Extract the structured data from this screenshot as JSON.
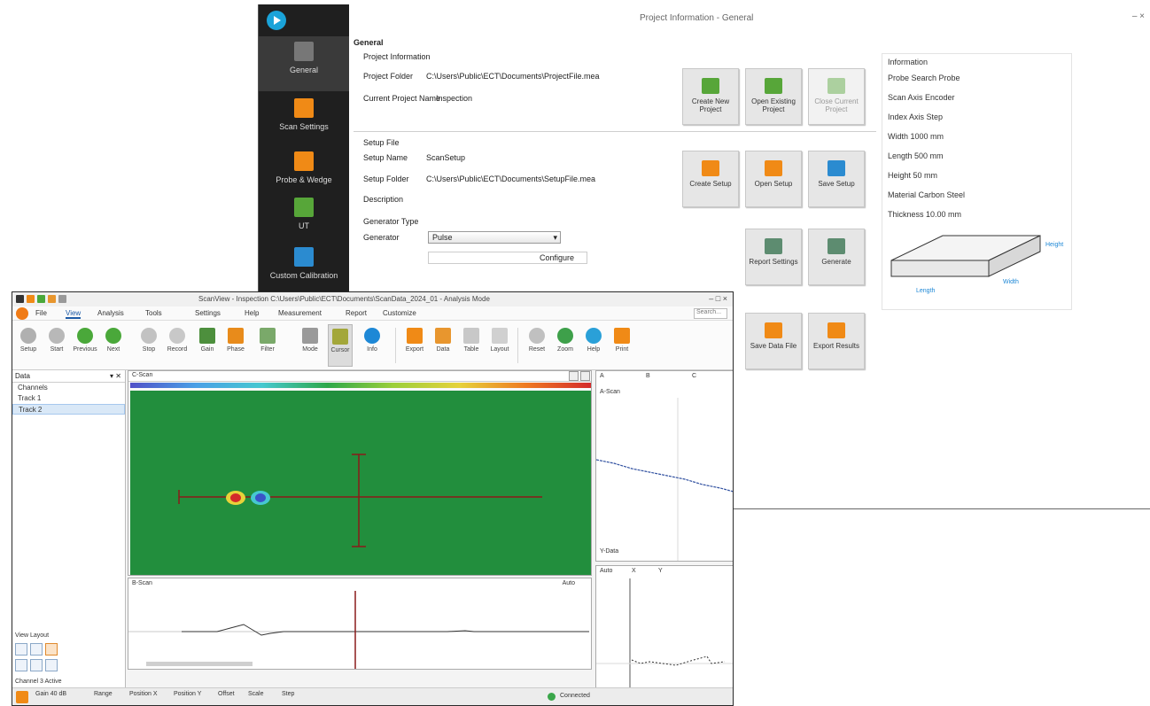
{
  "back_window": {
    "title": "Project Information - General",
    "window_controls": "– ×",
    "sidebar": [
      {
        "label": "General",
        "icon": "general-icon"
      },
      {
        "label": "Scan Settings",
        "icon": "scan-settings-icon"
      },
      {
        "label": "Probe & Wedge",
        "icon": "probe-wedge-icon"
      },
      {
        "label": "UT",
        "icon": "ut-icon"
      },
      {
        "label": "Custom Calibration",
        "icon": "calibration-icon"
      }
    ],
    "section_title": "General",
    "project_info": {
      "heading": "Project Information",
      "path_label": "Project Folder",
      "path_value": "C:\\Users\\Public\\ECT\\Documents\\ProjectFile.mea",
      "name_label": "Current Project Name",
      "name_value": "Inspection"
    },
    "project_buttons": [
      {
        "label": "Create New Project",
        "disabled": false
      },
      {
        "label": "Open Existing Project",
        "disabled": false
      },
      {
        "label": "Close Current Project",
        "disabled": true
      }
    ],
    "setup_info": {
      "heading": "Setup File",
      "setup_label": "Setup Name",
      "setup_value": "ScanSetup",
      "file_label": "Setup Folder",
      "file_value": "C:\\Users\\Public\\ECT\\Documents\\SetupFile.mea",
      "notes_label": "Description"
    },
    "setup_buttons": [
      {
        "label": "Create Setup"
      },
      {
        "label": "Open Setup"
      },
      {
        "label": "Save Setup"
      }
    ],
    "generator": {
      "heading": "Generator Type",
      "label": "Generator",
      "selected": "Pulse",
      "input_value": "Configure"
    },
    "report_buttons": [
      {
        "label": "Report Settings"
      },
      {
        "label": "Generate"
      }
    ],
    "lower_buttons": [
      {
        "label": "Save Data File"
      },
      {
        "label": "Export Results"
      }
    ],
    "info_panel": {
      "heading": "Information",
      "rows": [
        "Probe        Search Probe",
        "Scan Axis   Encoder",
        "Index Axis   Step",
        "Width        1000 mm",
        "Length        500 mm",
        "Height       50 mm",
        "Material     Carbon Steel",
        "Thickness    10.00 mm"
      ],
      "dim_labels": [
        "Length",
        "Width",
        "Height"
      ]
    }
  },
  "front_window": {
    "title": "ScanView - Inspection C:\\Users\\Public\\ECT\\Documents\\ScanData_2024_01 - Analysis Mode",
    "window_controls": "– □ ×",
    "menu_tabs": [
      "File",
      "View",
      "Analysis",
      "Tools",
      "Settings",
      "Help",
      "Measurement",
      "Report",
      "Customize"
    ],
    "active_tab": "View",
    "search_placeholder": "Search...",
    "ribbon": [
      {
        "label": "Setup",
        "color": "#b0b0b0"
      },
      {
        "label": "Start",
        "color": "#b8b8b8"
      },
      {
        "label": "Previous",
        "color": "#4aa83a"
      },
      {
        "label": "Next",
        "color": "#4aa83a"
      },
      {
        "label": "Stop",
        "color": "#c2c2c2"
      },
      {
        "label": "Record",
        "color": "#c8c8c8"
      },
      {
        "label": "Gain",
        "color": "#4d8f3d"
      },
      {
        "label": "Phase",
        "color": "#e88b1b"
      },
      {
        "label": "Filter",
        "color": "#7aa96a"
      },
      {
        "label": "Mode",
        "color": "#9a9a9a"
      },
      {
        "label": "Cursor",
        "color": "#a3a73a"
      },
      {
        "label": "Info",
        "color": "#1e88d6"
      },
      {
        "label": "Export",
        "color": "#f08a16"
      },
      {
        "label": "Data",
        "color": "#e8962e"
      },
      {
        "label": "Table",
        "color": "#c8c8c8"
      },
      {
        "label": "Layout",
        "color": "#d0d0d0"
      },
      {
        "label": "Reset",
        "color": "#c0c0c0"
      },
      {
        "label": "Zoom",
        "color": "#3ea04a"
      },
      {
        "label": "Help",
        "color": "#2aa0d8"
      },
      {
        "label": "Print",
        "color": "#f08a16"
      }
    ],
    "selected_ribbon": "Cursor",
    "tree": {
      "head": "Data",
      "head_right": "▾ ✕",
      "items": [
        "Channels",
        "Track 1",
        "Track 2"
      ],
      "selected": "Track 2"
    },
    "left_bottom_label": "View Layout",
    "left_status": "Channel 3 Active",
    "cscan_tab": "C-Scan",
    "bscan_tab": "B-Scan",
    "bscan_right": "Auto",
    "ascan": {
      "tabs": [
        "A",
        "B",
        "C"
      ],
      "label_top": "A-Scan",
      "label_bottom": "Y-Data"
    },
    "ascan2": {
      "tabs": [
        "Auto",
        "X",
        "Y"
      ]
    },
    "statusbar": {
      "items": [
        "Gain 40 dB",
        "Range",
        "Position X",
        "Position Y",
        "Offset",
        "Scale",
        "Step"
      ],
      "right": "Connected"
    }
  }
}
